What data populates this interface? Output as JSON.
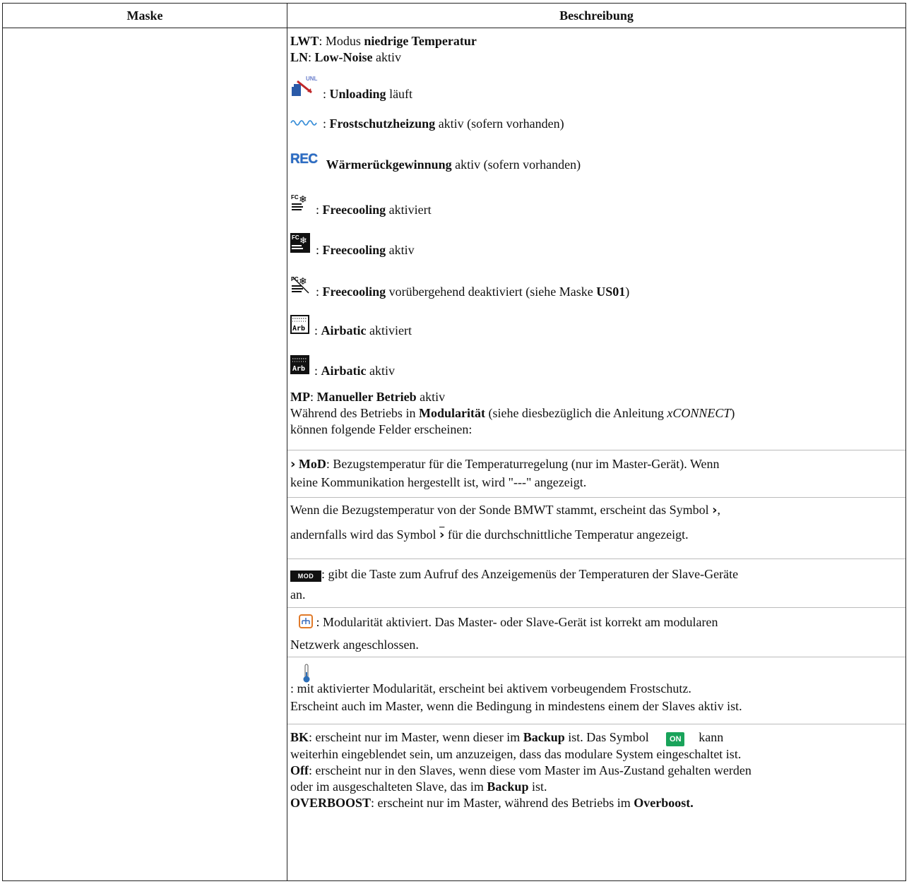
{
  "header": {
    "col1": "Maske",
    "col2": "Beschreibung"
  },
  "lines": {
    "lwt_key": "LWT",
    "lwt_sep": ": Modus ",
    "lwt_val": "niedrige Temperatur",
    "ln_key": "LN",
    "ln_sep": ": ",
    "ln_val": "Low-Noise",
    "ln_tail": " aktiv",
    "unl_sep": ": ",
    "unl_b": "Unloading",
    "unl_tail": " läuft",
    "frost_sep": ": ",
    "frost_b": "Frostschutzheizung",
    "frost_tail": " aktiv (sofern vorhanden)",
    "rec_label": "REC",
    "rec_b": "Wärmerückgewinnung",
    "rec_tail": " aktiv (sofern vorhanden)",
    "fc1_sep": ": ",
    "fc1_b": "Freecooling",
    "fc1_tail": " aktiviert",
    "fc2_sep": ": ",
    "fc2_b": "Freecooling",
    "fc2_tail": " aktiv",
    "fc3_sep": ": ",
    "fc3_b": "Freecooling",
    "fc3_mid": " vorübergehend deaktiviert (siehe Maske ",
    "fc3_b2": "US01",
    "fc3_tail": ")",
    "arb1_sep": ": ",
    "arb1_b": "Airbatic",
    "arb1_tail": " aktiviert",
    "arb2_sep": ": ",
    "arb2_b": "Airbatic",
    "arb2_tail": " aktiv",
    "mp_key": "MP",
    "mp_sep": ": ",
    "mp_b": "Manueller Betrieb",
    "mp_tail": " aktiv",
    "mod_intro_a": "Während des Betriebs in ",
    "mod_intro_b": "Modularität",
    "mod_intro_c": " (siehe diesbezüglich die Anleitung ",
    "mod_intro_i": "xCONNECT",
    "mod_intro_d": ")",
    "mod_intro_e": "können folgende Felder erscheinen:",
    "mod_key": "MoD",
    "mod_line1": ": Bezugstemperatur für die Temperaturregelung (nur im Master-Gerät). Wenn",
    "mod_line2": "keine Kommunikation hergestellt ist, wird \"---\" angezeigt.",
    "bmwt_line1": "Wenn die Bezugstemperatur von der Sonde BMWT stammt, erscheint das Symbol",
    "bmwt_line1_tail": ",",
    "bmwt_line2a": "andernfalls wird das Symbol",
    "bmwt_line2b": "für die durchschnittliche Temperatur angezeigt.",
    "modkey_label": "MOD",
    "modkey_line1": ": gibt die Taste zum Aufruf des Anzeigemenüs der Temperaturen der Slave-Geräte",
    "modkey_line2": "an.",
    "net_line1": ": Modularität aktiviert. Das Master- oder Slave-Gerät ist korrekt am modularen",
    "net_line2": "Netzwerk angeschlossen.",
    "therm_line1": ": mit aktivierter Modularität, erscheint bei aktivem vorbeugendem Frostschutz.",
    "therm_line2": "Erscheint auch im Master, wenn die Bedingung in mindestens einem der Slaves aktiv ist.",
    "bk_key": "BK",
    "bk_a": ": erscheint nur im Master, wenn dieser im ",
    "bk_b": "Backup",
    "bk_c": " ist. Das Symbol",
    "on_label": "ON",
    "bk_d": "kann",
    "bk_line2": "weiterhin eingeblendet sein, um anzuzeigen, dass das modulare System eingeschaltet ist.",
    "off_key": "Off",
    "off_a": ": erscheint nur in den Slaves, wenn diese vom Master im Aus-Zustand gehalten werden",
    "off_line2a": "oder im ausgeschalteten Slave, das im ",
    "off_line2b": "Backup",
    "off_line2c": " ist.",
    "ob_key": "OVERBOOST",
    "ob_a": ": erscheint nur im Master, während des Betriebs im ",
    "ob_b": "Overboost."
  },
  "icons": [
    "unloading-icon",
    "frost-heater-icon",
    "rec-icon",
    "freecooling-enabled-icon",
    "freecooling-active-icon",
    "freecooling-disabled-icon",
    "airbatic-enabled-icon",
    "airbatic-active-icon",
    "chevron-right-icon",
    "average-temp-icon",
    "mod-key-icon",
    "network-icon",
    "thermometer-icon",
    "on-icon"
  ],
  "colors": {
    "rec": "#2b6cc4",
    "on": "#19a35a",
    "frost": "#3a8fd8"
  }
}
